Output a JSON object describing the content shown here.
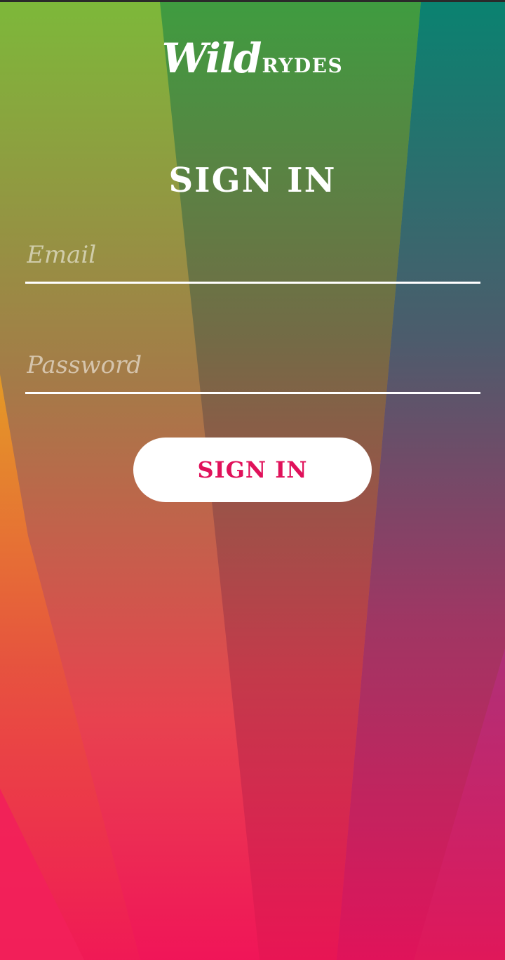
{
  "app": {
    "logo_primary": "Wild",
    "logo_secondary": "RYDES"
  },
  "form": {
    "heading": "SIGN IN",
    "email": {
      "value": "",
      "placeholder": "Email"
    },
    "password": {
      "value": "",
      "placeholder": "Password"
    },
    "submit_label": "SIGN IN"
  },
  "colors": {
    "accent": "#e0115a",
    "text_on_background": "#ffffff",
    "button_background": "#ffffff"
  }
}
